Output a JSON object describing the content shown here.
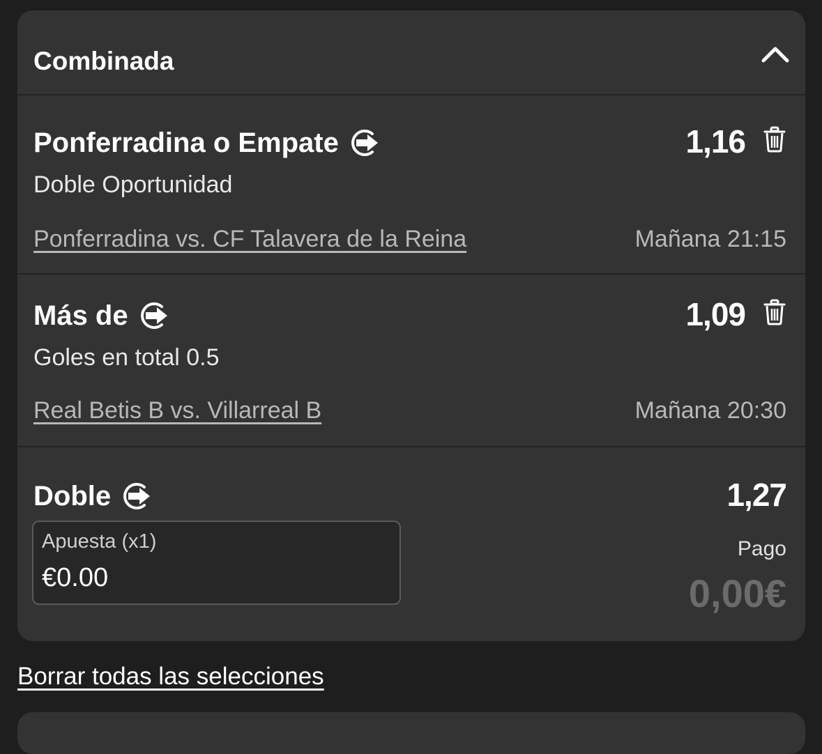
{
  "betslip": {
    "title": "Combinada",
    "collapse_icon": "chevron-up-icon",
    "selections": [
      {
        "title": "Ponferradina o Empate",
        "odds": "1,16",
        "market": "Doble Oportunidad",
        "match": "Ponferradina vs. CF Talavera de la Reina",
        "time": "Mañana 21:15"
      },
      {
        "title": "Más de",
        "odds": "1,09",
        "market": "Goles en total 0.5",
        "match": "Real Betis B vs. Villarreal B",
        "time": "Mañana 20:30"
      }
    ],
    "summary": {
      "title": "Doble",
      "odds": "1,27",
      "stake_label": "Apuesta (x1)",
      "stake_value": "€0.00",
      "payout_label": "Pago",
      "payout_value": "0,00€"
    }
  },
  "clear_all_label": "Borrar todas las selecciones",
  "colors": {
    "background": "#1e1e1e",
    "card": "#333333",
    "text_primary": "#ffffff",
    "text_secondary": "#b8b8b8",
    "payout_muted": "#6b6b6b"
  }
}
